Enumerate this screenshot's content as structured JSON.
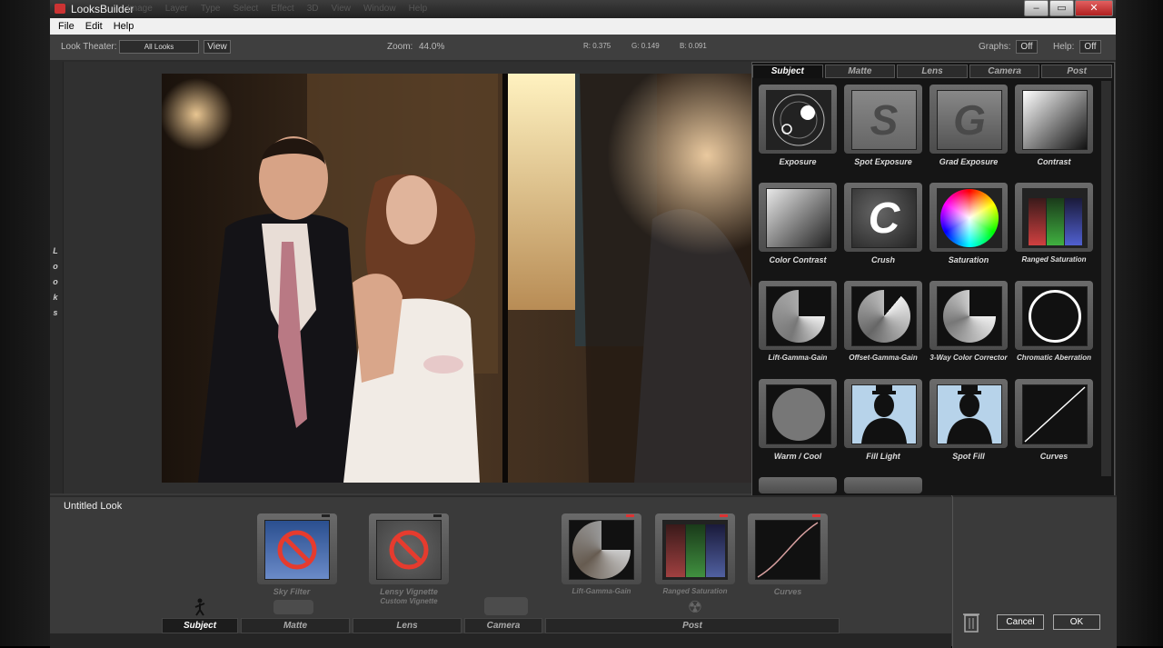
{
  "window": {
    "title": "LooksBuilder",
    "blur_menu": [
      "Image",
      "Layer",
      "Type",
      "Select",
      "Effect",
      "3D",
      "View",
      "Window",
      "Help"
    ]
  },
  "menu": [
    "File",
    "Edit",
    "Help"
  ],
  "toolbar": {
    "look_theater_label": "Look Theater:",
    "look_theater_value": "All Looks",
    "view_button": "View",
    "zoom_label": "Zoom:",
    "zoom_value": "44.0%",
    "r": "R: 0.375",
    "g": "G: 0.149",
    "b": "B: 0.091",
    "graphs_label": "Graphs:",
    "graphs_value": "Off",
    "help_label": "Help:",
    "help_value": "Off"
  },
  "side_tab": [
    "L",
    "o",
    "o",
    "k",
    "s"
  ],
  "panel": {
    "tabs": [
      "Subject",
      "Matte",
      "Lens",
      "Camera",
      "Post"
    ],
    "tools": [
      {
        "label": "Exposure",
        "icon": "exposure-icon"
      },
      {
        "label": "Spot Exposure",
        "icon": "spot-exposure-icon",
        "glyph": "S"
      },
      {
        "label": "Grad Exposure",
        "icon": "grad-exposure-icon",
        "glyph": "G"
      },
      {
        "label": "Contrast",
        "icon": "contrast-icon"
      },
      {
        "label": "Color Contrast",
        "icon": "color-contrast-icon"
      },
      {
        "label": "Crush",
        "icon": "crush-icon",
        "glyph": "C"
      },
      {
        "label": "Saturation",
        "icon": "saturation-icon"
      },
      {
        "label": "Ranged Saturation",
        "icon": "ranged-saturation-icon"
      },
      {
        "label": "Lift-Gamma-Gain",
        "icon": "lift-gamma-gain-icon"
      },
      {
        "label": "Offset-Gamma-Gain",
        "icon": "offset-gamma-gain-icon"
      },
      {
        "label": "3-Way Color Corrector",
        "icon": "three-way-color-corrector-icon"
      },
      {
        "label": "Chromatic Aberration",
        "icon": "chromatic-aberration-icon"
      },
      {
        "label": "Warm / Cool",
        "icon": "warm-cool-icon"
      },
      {
        "label": "Fill Light",
        "icon": "fill-light-icon"
      },
      {
        "label": "Spot Fill",
        "icon": "spot-fill-icon"
      },
      {
        "label": "Curves",
        "icon": "curves-icon"
      }
    ]
  },
  "bottom": {
    "look_name": "Untitled Look",
    "stack": [
      {
        "label": "Sky Filter",
        "icon": "no-entry-icon"
      },
      {
        "label": "Lensy Vignette",
        "sublabel": "Custom Vignette",
        "icon": "no-entry-icon"
      },
      {
        "label": "Lift-Gamma-Gain",
        "icon": "lift-gamma-gain-icon"
      },
      {
        "label": "Ranged Saturation",
        "icon": "ranged-saturation-icon"
      },
      {
        "label": "Curves",
        "icon": "curves-icon"
      }
    ],
    "tabs": [
      "Subject",
      "Matte",
      "Lens",
      "Camera",
      "Post"
    ],
    "cancel": "Cancel",
    "ok": "OK"
  }
}
